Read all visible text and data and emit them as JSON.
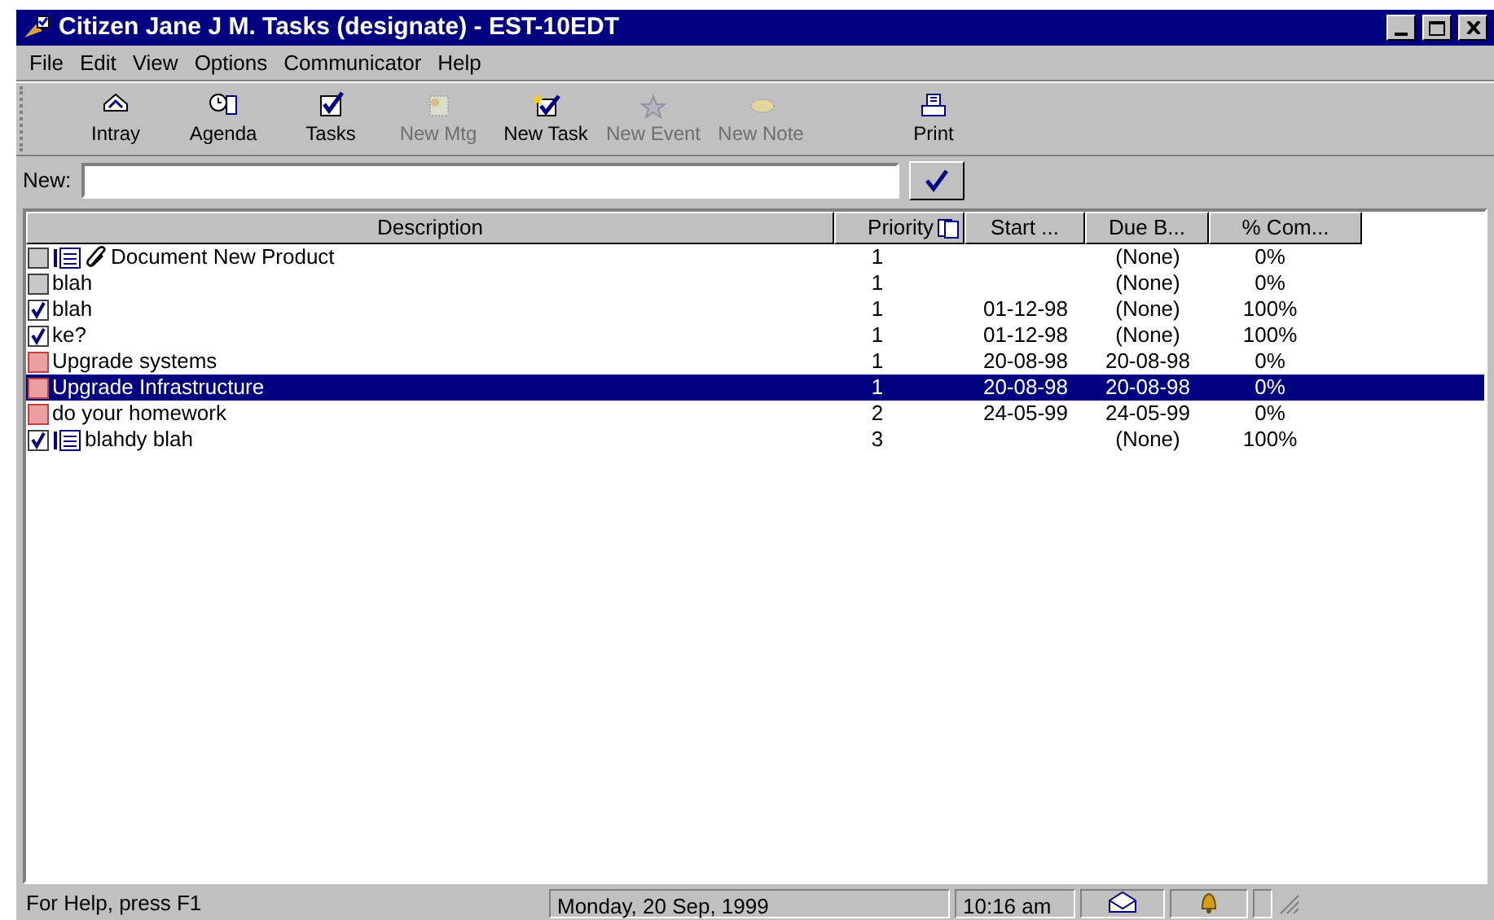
{
  "window": {
    "title": "Citizen Jane J M. Tasks (designate) - EST-10EDT"
  },
  "menu": [
    "File",
    "Edit",
    "View",
    "Options",
    "Communicator",
    "Help"
  ],
  "toolbar": [
    {
      "label": "Intray",
      "kind": "intray",
      "disabled": false
    },
    {
      "label": "Agenda",
      "kind": "agenda",
      "disabled": false
    },
    {
      "label": "Tasks",
      "kind": "tasks",
      "disabled": false
    },
    {
      "label": "New Mtg",
      "kind": "mtg",
      "disabled": true
    },
    {
      "label": "New Task",
      "kind": "newtask",
      "disabled": false
    },
    {
      "label": "New Event",
      "kind": "event",
      "disabled": true
    },
    {
      "label": "New Note",
      "kind": "note",
      "disabled": true
    },
    {
      "label": "Print",
      "kind": "print",
      "disabled": false
    }
  ],
  "new_field": {
    "label": "New:"
  },
  "table": {
    "columns": [
      "Description",
      "Priority",
      "Start ...",
      "Due B...",
      "% Com..."
    ],
    "rows": [
      {
        "kind": "open",
        "note": true,
        "attachment": true,
        "selected": false,
        "cells": [
          "Document New Product",
          "1",
          "",
          "(None)",
          "0%"
        ]
      },
      {
        "kind": "open",
        "note": false,
        "attachment": false,
        "selected": false,
        "cells": [
          "blah",
          "1",
          "",
          "(None)",
          "0%"
        ]
      },
      {
        "kind": "done",
        "note": false,
        "attachment": false,
        "selected": false,
        "cells": [
          "blah",
          "1",
          "01-12-98",
          "(None)",
          "100%"
        ]
      },
      {
        "kind": "done",
        "note": false,
        "attachment": false,
        "selected": false,
        "cells": [
          "ke?",
          "1",
          "01-12-98",
          "(None)",
          "100%"
        ]
      },
      {
        "kind": "overdue",
        "note": false,
        "attachment": false,
        "selected": false,
        "cells": [
          "Upgrade systems",
          "1",
          "20-08-98",
          "20-08-98",
          "0%"
        ]
      },
      {
        "kind": "overdue",
        "note": false,
        "attachment": false,
        "selected": true,
        "cells": [
          "Upgrade Infrastructure",
          "1",
          "20-08-98",
          "20-08-98",
          "0%"
        ]
      },
      {
        "kind": "overdue",
        "note": false,
        "attachment": false,
        "selected": false,
        "cells": [
          "do your homework",
          "2",
          "24-05-99",
          "24-05-99",
          "0%"
        ]
      },
      {
        "kind": "done",
        "note": true,
        "attachment": false,
        "selected": false,
        "cells": [
          "blahdy blah",
          "3",
          "",
          "(None)",
          "100%"
        ]
      }
    ]
  },
  "status_bar": {
    "help": "For Help, press F1",
    "date": "Monday, 20 Sep, 1999",
    "time": "10:16 am"
  }
}
